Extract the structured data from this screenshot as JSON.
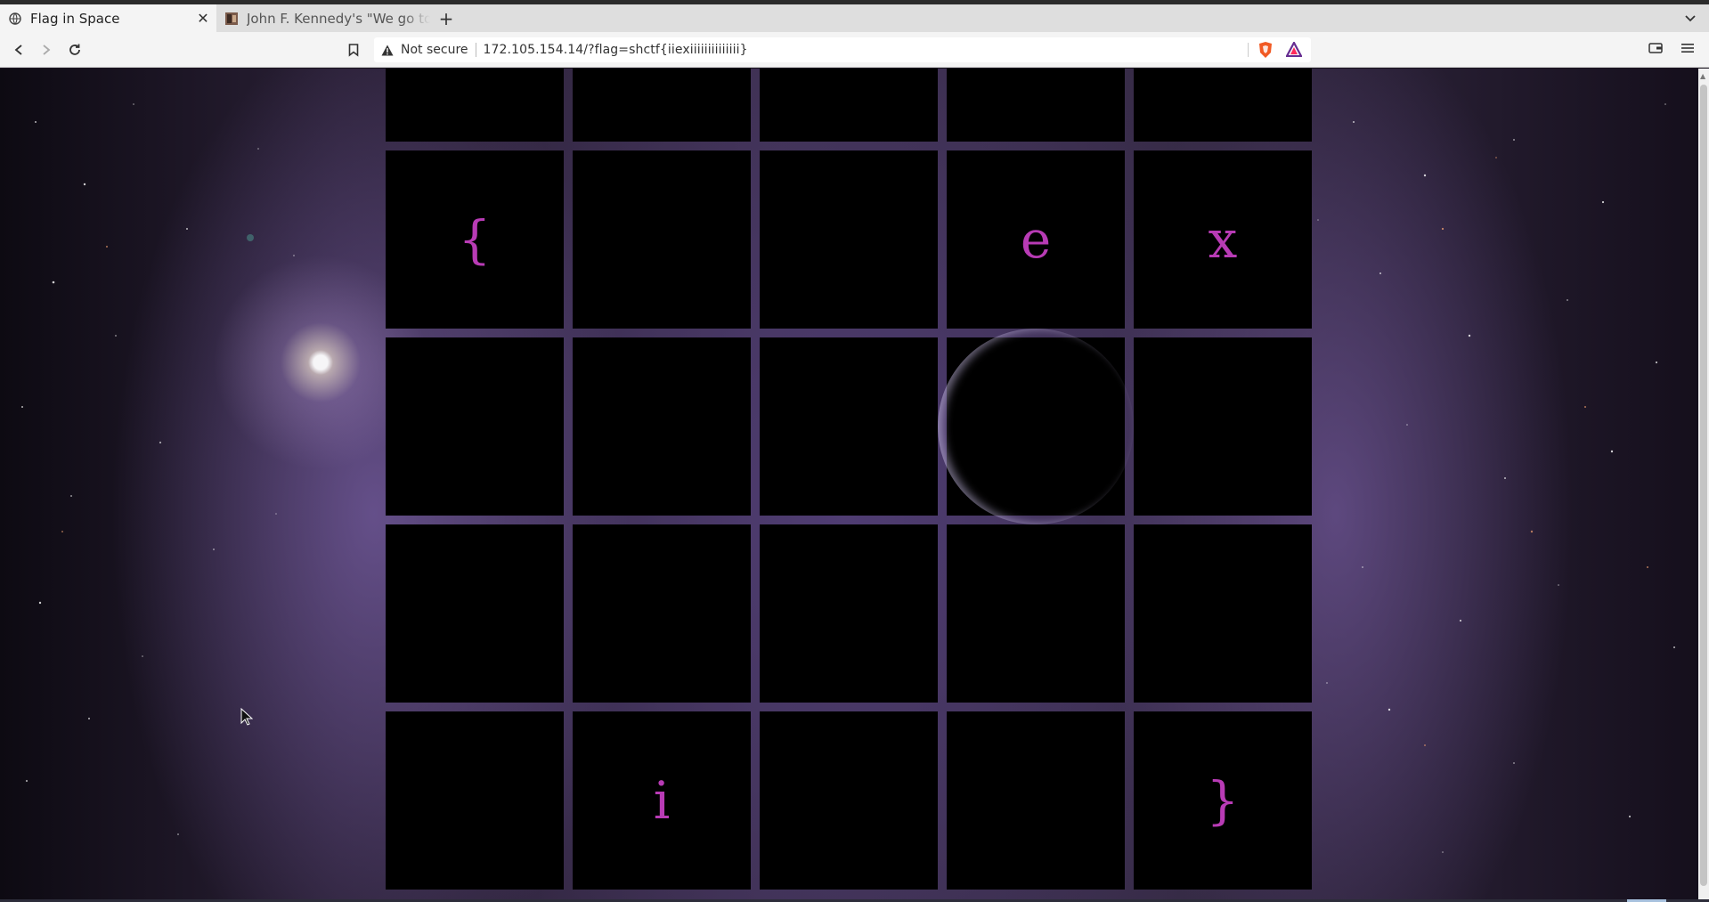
{
  "browser": {
    "tabs": [
      {
        "title": "Flag in Space",
        "active": true
      },
      {
        "title": "John F. Kennedy's \"We go to t",
        "active": false
      }
    ],
    "new_tab_label": "+",
    "close_label": "✕",
    "security_label": "Not secure",
    "url": "172.105.154.14/?flag=shctf{iiexiiiiiiiiiiiiii}"
  },
  "page": {
    "cells": [
      "",
      "",
      "",
      "",
      "",
      "{",
      "",
      "",
      "e",
      "x",
      "",
      "",
      "",
      "",
      "",
      "",
      "",
      "",
      "",
      "",
      "",
      "i",
      "",
      "",
      "}"
    ]
  },
  "colors": {
    "letter": "#b83bb5",
    "cell": "#000000",
    "grid_gap": "#4f3f69"
  }
}
